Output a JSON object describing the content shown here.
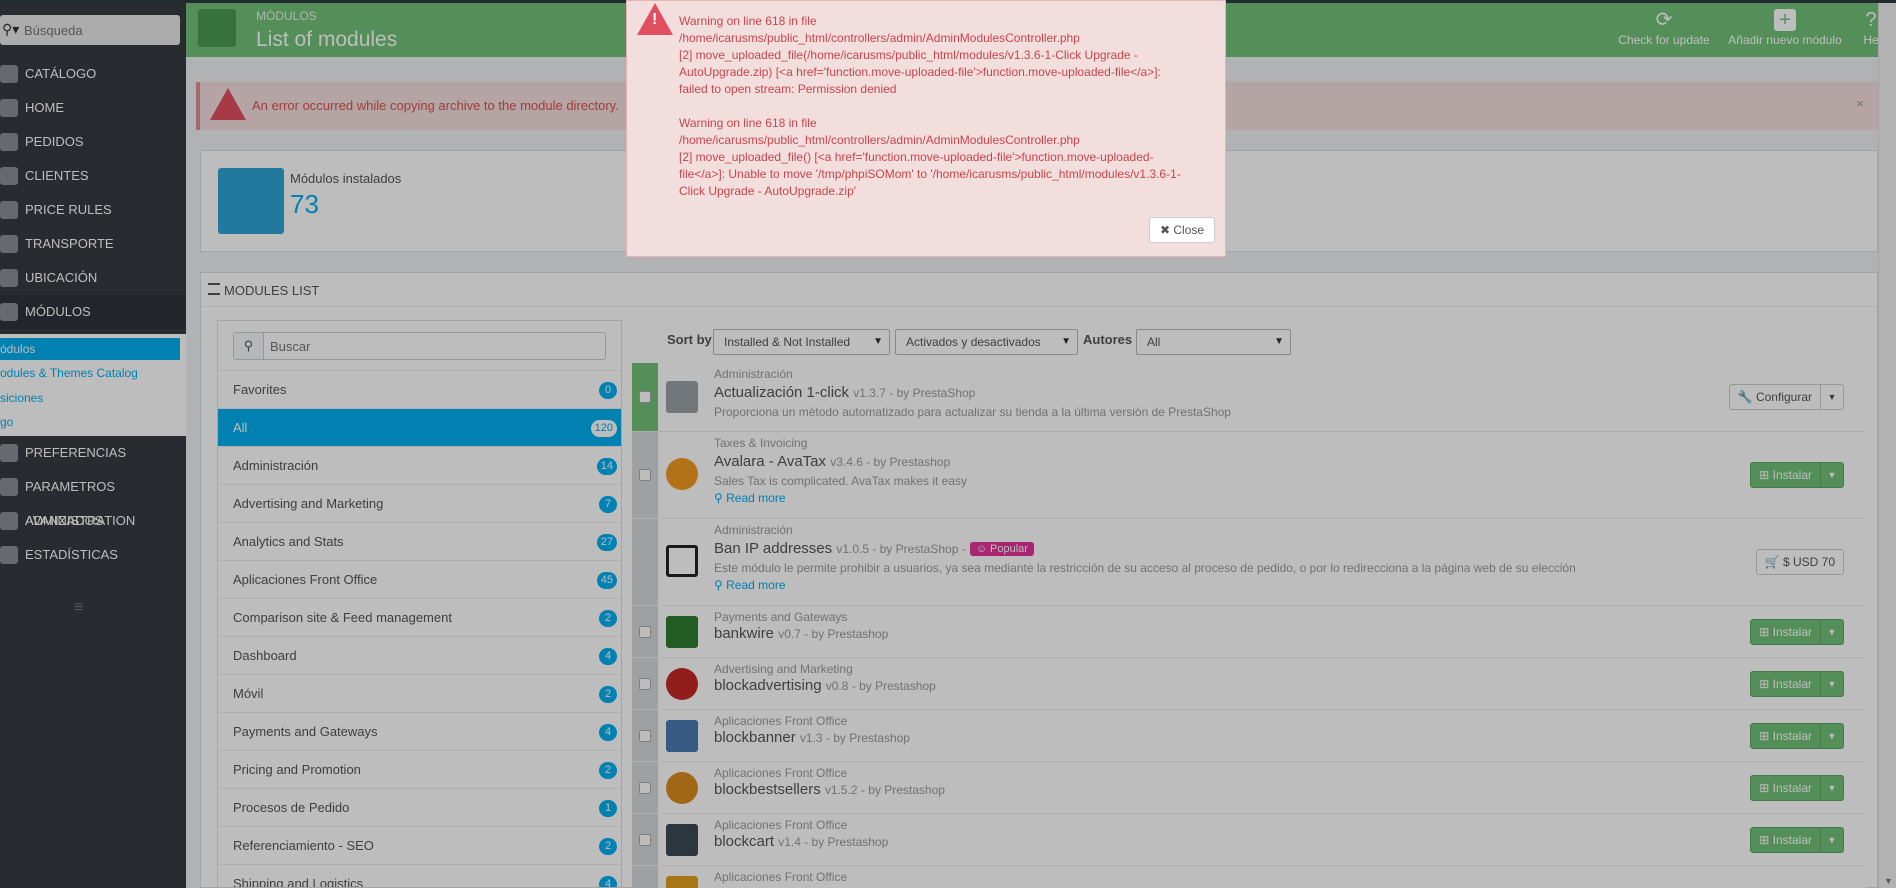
{
  "sidebar": {
    "search_placeholder": "Búsqueda",
    "items": [
      {
        "label": "CATÁLOGO"
      },
      {
        "label": "HOME"
      },
      {
        "label": "PEDIDOS"
      },
      {
        "label": "CLIENTES"
      },
      {
        "label": "PRICE RULES"
      },
      {
        "label": "TRANSPORTE"
      },
      {
        "label": "UBICACIÓN"
      },
      {
        "label": "MÓDULOS"
      },
      {
        "label": "PREFERENCIAS"
      },
      {
        "label": "PARAMETROS AVANZADOS"
      },
      {
        "label": "ADMINISTRATION"
      },
      {
        "label": "ESTADÍSTICAS"
      }
    ],
    "subitems": [
      {
        "label": "ódulos"
      },
      {
        "label": "odules & Themes Catalog"
      },
      {
        "label": "siciones"
      },
      {
        "label": "go"
      }
    ],
    "collapse_icon": "≡"
  },
  "header": {
    "breadcrumb": "MÓDULOS",
    "title": "List of modules",
    "buttons": [
      {
        "label": "Check for update",
        "icon": "refresh-icon"
      },
      {
        "label": "Añadir nuevo módulo",
        "icon": "plus-icon"
      },
      {
        "label": "He",
        "icon": "help-icon"
      }
    ]
  },
  "alert": {
    "text": "An error occurred while copying archive to the module directory.",
    "close": "×"
  },
  "kpi": {
    "label": "Módulos instalados",
    "value": "73"
  },
  "panel": {
    "title": "MODULES LIST"
  },
  "categories": {
    "search_placeholder": "Buscar",
    "items": [
      {
        "name": "Favorites",
        "count": "0"
      },
      {
        "name": "All",
        "count": "120"
      },
      {
        "name": "Administración",
        "count": "14"
      },
      {
        "name": "Advertising and Marketing",
        "count": "7"
      },
      {
        "name": "Analytics and Stats",
        "count": "27"
      },
      {
        "name": "Aplicaciones Front Office",
        "count": "45"
      },
      {
        "name": "Comparison site & Feed management",
        "count": "2"
      },
      {
        "name": "Dashboard",
        "count": "4"
      },
      {
        "name": "Móvil",
        "count": "2"
      },
      {
        "name": "Payments and Gateways",
        "count": "4"
      },
      {
        "name": "Pricing and Promotion",
        "count": "2"
      },
      {
        "name": "Procesos de Pedido",
        "count": "1"
      },
      {
        "name": "Referenciamiento - SEO",
        "count": "2"
      },
      {
        "name": "Shipping and Logistics",
        "count": "4"
      }
    ]
  },
  "toolbar": {
    "sort_label": "Sort by",
    "sort_value": "Installed & Not Installed",
    "status_value": "Activados y desactivados",
    "authors_label": "Autores",
    "authors_value": "All"
  },
  "modules": [
    {
      "category": "Administración",
      "name": "Actualización 1-click",
      "version": "v1.3.7 - by PrestaShop",
      "desc": "Proporciona un método automatizado para actualizar su tienda a la última versión de PrestaShop",
      "action": "Configurar"
    },
    {
      "category": "Taxes & Invoicing",
      "name": "Avalara - AvaTax",
      "version": "v3.4.6 - by Prestashop",
      "desc": "Sales Tax is complicated. AvaTax makes it easy",
      "readmore": "Read more",
      "action": "Instalar"
    },
    {
      "category": "Administración",
      "name": "Ban IP addresses",
      "version": "v1.0.5 - by PrestaShop -",
      "badge": "Popular",
      "desc": "Este módulo le permite prohibir a usuarios, ya sea mediante la restricción de su acceso al proceso de pedido, o por lo redirecciona a la página web de su elección",
      "readmore": "Read more",
      "action": "$ USD 70"
    },
    {
      "category": "Payments and Gateways",
      "name": "bankwire",
      "version": "v0.7 - by Prestashop",
      "action": "Instalar"
    },
    {
      "category": "Advertising and Marketing",
      "name": "blockadvertising",
      "version": "v0.8 - by Prestashop",
      "action": "Instalar"
    },
    {
      "category": "Aplicaciones Front Office",
      "name": "blockbanner",
      "version": "v1.3 - by Prestashop",
      "action": "Instalar"
    },
    {
      "category": "Aplicaciones Front Office",
      "name": "blockbestsellers",
      "version": "v1.5.2 - by Prestashop",
      "action": "Instalar"
    },
    {
      "category": "Aplicaciones Front Office",
      "name": "blockcart",
      "version": "v1.4 - by Prestashop",
      "action": "Instalar"
    },
    {
      "category": "Aplicaciones Front Office"
    }
  ],
  "modal": {
    "warning1": "Warning on line 618 in file\n/home/icarusms/public_html/controllers/admin/AdminModulesController.php\n[2] move_uploaded_file(/home/icarusms/public_html/modules/v1.3.6-1-Click Upgrade -\nAutoUpgrade.zip) [<a href='function.move-uploaded-file'>function.move-uploaded-file</a>]:\nfailed to open stream: Permission denied",
    "warning2": "Warning on line 618 in file\n/home/icarusms/public_html/controllers/admin/AdminModulesController.php\n[2] move_uploaded_file() [<a href='function.move-uploaded-file'>function.move-uploaded-\nfile</a>]: Unable to move '/tmp/phpiSOMom' to '/home/icarusms/public_html/modules/v1.3.6-1-\nClick Upgrade - AutoUpgrade.zip'",
    "close_label": "Close"
  },
  "colors": {
    "sidebar": "#363a41",
    "header": "#72c279",
    "accent": "#00aff0",
    "error": "#d9534f",
    "popular": "#e2329b"
  }
}
